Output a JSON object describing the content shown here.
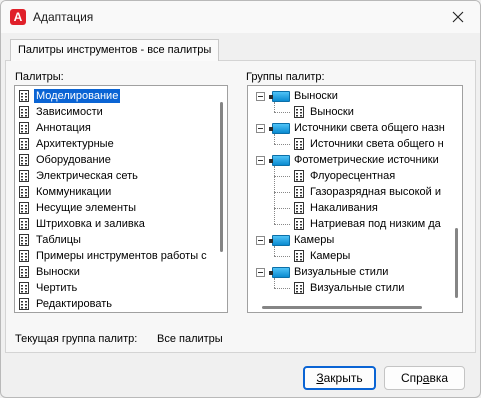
{
  "window": {
    "title": "Адаптация",
    "app_icon_letter": "A",
    "accent_color": "#0a64d4",
    "brand_color": "#e0202a"
  },
  "tab": {
    "label": "Палитры инструментов - все палитры"
  },
  "palettes": {
    "label": "Палитры:",
    "items": [
      "Моделирование",
      "Зависимости",
      "Аннотация",
      "Архитектурные",
      "Оборудование",
      "Электрическая сеть",
      "Коммуникации",
      "Несущие элементы",
      "Штриховка и заливка",
      "Таблицы",
      "Примеры инструментов работы с",
      "Выноски",
      "Чертить",
      "Редактировать"
    ],
    "selected_index": 0
  },
  "groups": {
    "label": "Группы палитр:",
    "tree": [
      {
        "level": 0,
        "label": "Выноски"
      },
      {
        "level": 1,
        "label": "Выноски"
      },
      {
        "level": 0,
        "label": "Источники света общего назн"
      },
      {
        "level": 1,
        "label": "Источники света общего н"
      },
      {
        "level": 0,
        "label": "Фотометрические источники"
      },
      {
        "level": 1,
        "label": "Флуоресцентная"
      },
      {
        "level": 1,
        "label": "Газоразрядная высокой и"
      },
      {
        "level": 1,
        "label": "Накаливания"
      },
      {
        "level": 1,
        "label": "Натриевая под низким да"
      },
      {
        "level": 0,
        "label": "Камеры"
      },
      {
        "level": 1,
        "label": "Камеры"
      },
      {
        "level": 0,
        "label": "Визуальные стили"
      },
      {
        "level": 1,
        "label": "Визуальные стили"
      }
    ]
  },
  "current_group": {
    "label": "Текущая группа палитр:",
    "value": "Все палитры"
  },
  "buttons": {
    "close": {
      "prefix": "",
      "accel": "З",
      "rest": "акрыть"
    },
    "help": {
      "prefix": "Спр",
      "accel": "а",
      "rest": "вка"
    }
  }
}
